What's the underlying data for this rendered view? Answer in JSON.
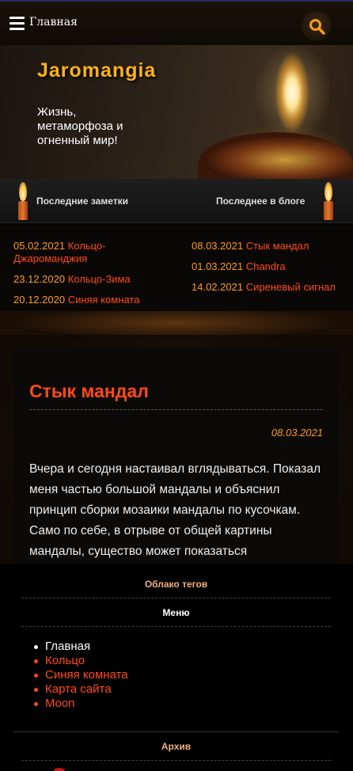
{
  "nav": {
    "home_label": "Главная"
  },
  "hero": {
    "site_title": "Jaromangia",
    "tagline": "Жизнь, метаморфоза и огненный мир!"
  },
  "latest_bar": {
    "left_label": "Последние заметки",
    "right_label": "Последнее в блоге"
  },
  "latest_notes": [
    {
      "date": "05.02.2021",
      "title": "Кольцо-Джароманджия"
    },
    {
      "date": "23.12.2020",
      "title": "Кольцо-Зима"
    },
    {
      "date": "20.12.2020",
      "title": "Синяя комната"
    }
  ],
  "latest_blog": [
    {
      "date": "08.03.2021",
      "title": "Стык мандал"
    },
    {
      "date": "01.03.2021",
      "title": "Chandra"
    },
    {
      "date": "14.02.2021",
      "title": "Сиреневый сигнал"
    }
  ],
  "post": {
    "title": "Стык мандал",
    "date": "08.03.2021",
    "body": "Вчера и сегодня настаивал вглядываться. Показал меня частью большой мандалы и объяснил принцип сборки мозаики мандалы по кусочкам. Само по себе, в отрыве от общей картины мандалы, существо может показаться"
  },
  "sidebar": {
    "tags_heading": "Облако тегов",
    "menu_heading": "Меню",
    "menu_items": [
      "Главная",
      "Кольцо",
      "Синяя комната",
      "Карта сайта",
      "Moon"
    ],
    "archive_heading": "Архив"
  },
  "colors": {
    "accent_orange": "#ff9a1a",
    "link_red": "#ff4a1a",
    "title_gold": "#ffb21a",
    "tag_heading": "#f0b080"
  }
}
